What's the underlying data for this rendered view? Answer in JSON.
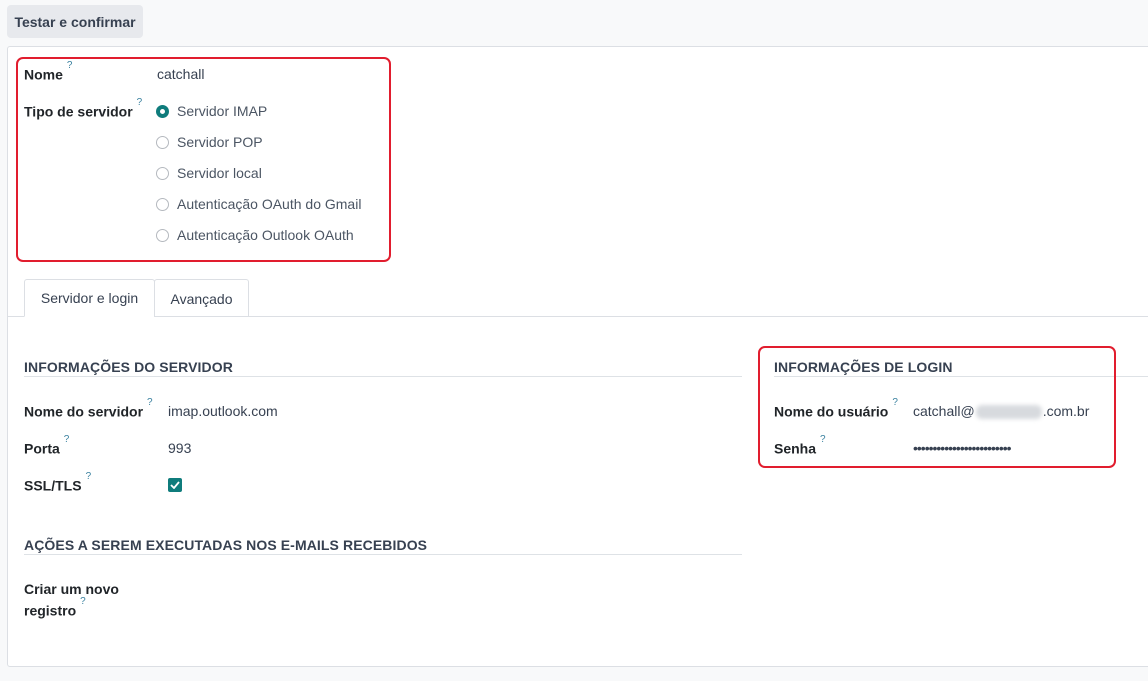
{
  "toolbar": {
    "test_confirm_label": "Testar e confirmar"
  },
  "general": {
    "name_label": "Nome",
    "name_value": "catchall",
    "server_type_label": "Tipo de servidor",
    "server_types": [
      {
        "label": "Servidor IMAP",
        "checked": true
      },
      {
        "label": "Servidor POP",
        "checked": false
      },
      {
        "label": "Servidor local",
        "checked": false
      },
      {
        "label": "Autenticação OAuth do Gmail",
        "checked": false
      },
      {
        "label": "Autenticação Outlook OAuth",
        "checked": false
      }
    ]
  },
  "help_mark": "?",
  "tabs": [
    {
      "label": "Servidor e login",
      "active": true
    },
    {
      "label": "Avançado",
      "active": false
    }
  ],
  "server_info": {
    "title": "INFORMAÇÕES DO SERVIDOR",
    "server_name_label": "Nome do servidor",
    "server_name_value": "imap.outlook.com",
    "port_label": "Porta",
    "port_value": "993",
    "ssl_label": "SSL/TLS",
    "ssl_checked": true
  },
  "actions": {
    "title": "AÇÕES A SEREM EXECUTADAS NOS E-MAILS RECEBIDOS",
    "create_record_label_line1": "Criar um novo",
    "create_record_label_line2": "registro"
  },
  "login_info": {
    "title": "INFORMAÇÕES DE LOGIN",
    "username_label": "Nome do usuário",
    "username_prefix": "catchall@",
    "username_suffix": ".com.br",
    "password_label": "Senha",
    "password_value": "•••••••••••••••••••••••••"
  },
  "colors": {
    "accent": "#0f7c7c",
    "highlight": "#e11d2e"
  }
}
